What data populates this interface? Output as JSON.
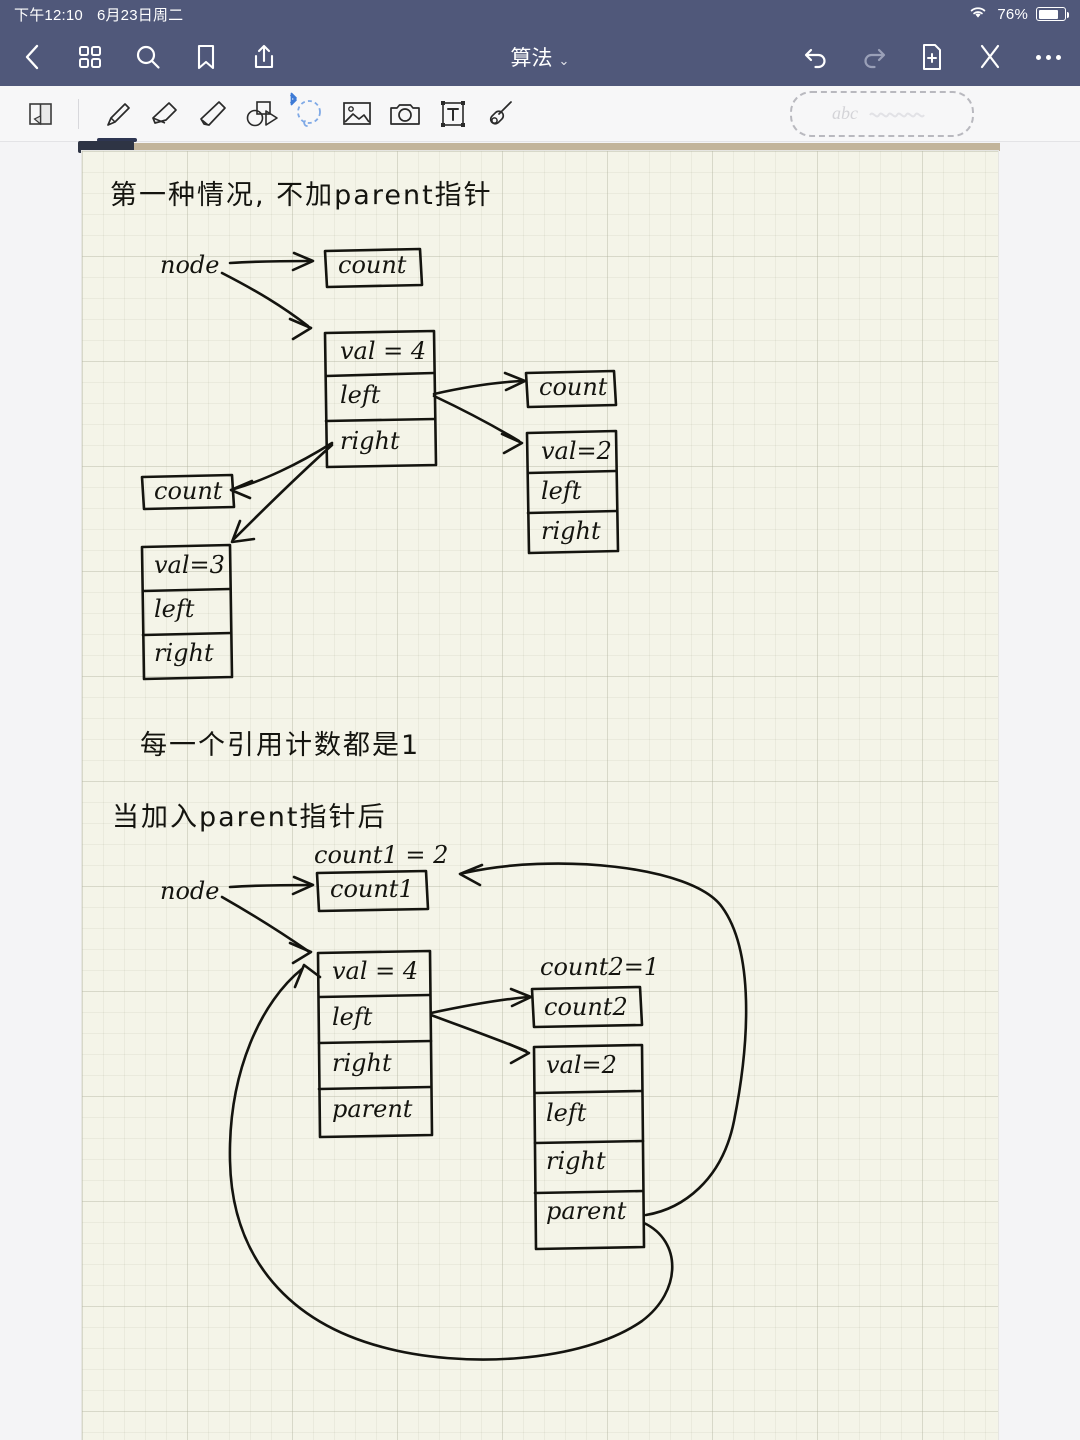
{
  "statusbar": {
    "time": "下午12:10",
    "date": "6月23日周二",
    "battery_percent": "76%",
    "wifi_icon": "wifi-icon",
    "battery_icon": "battery-icon"
  },
  "navbar": {
    "title": "算法",
    "title_caret": "⌄",
    "back_icon": "back-chevron-icon",
    "grid_icon": "grid-icon",
    "search_icon": "search-icon",
    "bookmark_icon": "bookmark-icon",
    "share_icon": "share-icon",
    "undo_icon": "undo-icon",
    "redo_icon": "redo-icon",
    "add_page_icon": "add-page-icon",
    "scissors_icon": "scissors-icon",
    "more_icon": "more-icon"
  },
  "toolbar": {
    "page_setup_icon": "page-setup-icon",
    "pen_icon": "pen-icon",
    "eraser_icon": "eraser-icon",
    "highlighter_icon": "highlighter-icon",
    "shapes_icon": "shapes-icon",
    "lasso_icon": "lasso-select-icon",
    "bluetooth_icon": "bluetooth-icon",
    "image_icon": "image-icon",
    "camera_icon": "camera-icon",
    "text_box_icon": "text-box-icon",
    "laser_pointer_icon": "laser-pointer-icon",
    "handwriting_hint": "abc",
    "active_tool": "pen-icon"
  },
  "note": {
    "section1": {
      "heading": "第一种情况, 不加parent指针",
      "node_label": "node",
      "root_count_label": "count",
      "root": {
        "val": "val = 4",
        "left": "left",
        "right": "right"
      },
      "right_child_count": "count",
      "right_child": {
        "val": "val=2",
        "left": "left",
        "right": "right"
      },
      "left_child_count": "count",
      "left_child": {
        "val": "val=3",
        "left": "left",
        "right": "right"
      },
      "note_text": "每一个引用计数都是1"
    },
    "section2": {
      "heading": "当加入parent指针后",
      "node_label": "node",
      "count1_value": "count1 = 2",
      "count1_box": "count1",
      "root": {
        "val": "val = 4",
        "left": "left",
        "right": "right",
        "parent": "parent"
      },
      "count2_value": "count2=1",
      "count2_box": "count2",
      "child": {
        "val": "val=2",
        "left": "left",
        "right": "right",
        "parent": "parent"
      }
    }
  },
  "colors": {
    "chrome": "#50587a",
    "toolbar_bg": "#f7f7f8",
    "paper": "#f4f4e8",
    "ink": "#14140f",
    "accent_blue": "#3d7ad6",
    "scroll_thumb": "#2e3444",
    "scroll_track": "#c2b49a"
  }
}
